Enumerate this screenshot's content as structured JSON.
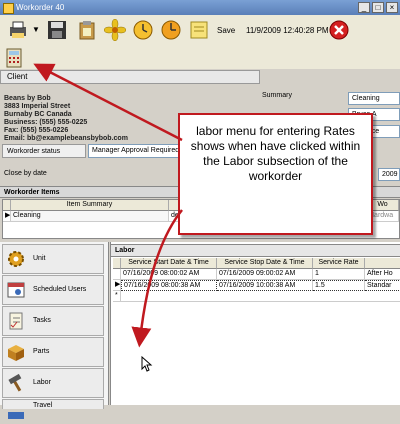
{
  "window": {
    "title": "Workorder 40"
  },
  "toolbar": {
    "save_label": "Save",
    "datetime": "11/9/2009 12:40:28 PM"
  },
  "client": {
    "label": "Client"
  },
  "address": {
    "lines": [
      "Beans by Bob",
      "3883 Imperial Street",
      "Burnaby BC Canada",
      "Business: (555) 555-0225",
      "Fax: (555) 555-0226",
      "Email: bb@examplebeansbybob.com"
    ]
  },
  "summary": {
    "label": "Summary",
    "value": "Cleaning",
    "value2": "Bruce A",
    "value3": "ance"
  },
  "workorder_status": {
    "label": "Workorder status",
    "value": "Manager Approval Required"
  },
  "close_by": {
    "label": "Close by date",
    "value": "2009 08"
  },
  "items": {
    "section_label": "Workorder Items",
    "columns": [
      "Item Summary",
      "Wo"
    ],
    "row": {
      "summary": "Cleaning",
      "extra": "de",
      "right": "Hardwa"
    }
  },
  "sidebar": {
    "items": [
      {
        "label": "Unit",
        "icon": "unit-gear-icon"
      },
      {
        "label": "Scheduled Users",
        "icon": "scheduled-users-icon"
      },
      {
        "label": "Tasks",
        "icon": "tasks-icon"
      },
      {
        "label": "Parts",
        "icon": "parts-box-icon"
      },
      {
        "label": "Labor",
        "icon": "labor-hammer-icon"
      },
      {
        "label": "Travel",
        "icon": "travel-icon"
      }
    ]
  },
  "labor": {
    "section_label": "Labor",
    "columns": [
      "Service Start Date & Time",
      "Service Stop Date & Time",
      "Service Rate",
      ""
    ],
    "rows": [
      {
        "start": "07/16/2009 08:00:02 AM",
        "stop": "07/16/2009 09:00:02 AM",
        "rate": "1",
        "name": "After Ho"
      },
      {
        "start": "07/16/2009 08:00:38 AM",
        "stop": "07/16/2009 10:00:38 AM",
        "rate": "1.5",
        "name": "Standar"
      }
    ],
    "new_row_marker": "*"
  },
  "callout": {
    "text": "labor menu for entering Rates shows when have clicked within the Labor subsection of the workorder"
  },
  "colors": {
    "callout_border": "#c0191f",
    "arrow": "#c0191f"
  }
}
